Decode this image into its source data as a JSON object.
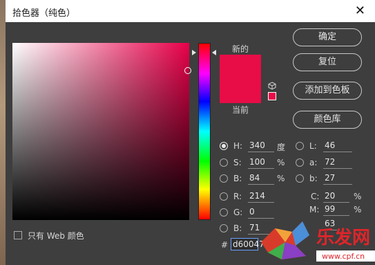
{
  "window": {
    "title": "拾色器（纯色）",
    "close_icon": "close-icon"
  },
  "swatch": {
    "new_label": "新的",
    "current_label": "当前",
    "color": "#e80c47"
  },
  "buttons": {
    "ok": "确定",
    "reset": "复位",
    "add_to_swatches": "添加到色板",
    "color_libraries": "颜色库"
  },
  "hsb": {
    "h": {
      "label": "H:",
      "value": "340",
      "unit": "度"
    },
    "s": {
      "label": "S:",
      "value": "100",
      "unit": "%"
    },
    "b": {
      "label": "B:",
      "value": "84",
      "unit": "%"
    }
  },
  "rgb": {
    "r": {
      "label": "R:",
      "value": "214"
    },
    "g": {
      "label": "G:",
      "value": "0"
    },
    "b": {
      "label": "B:",
      "value": "71"
    }
  },
  "lab": {
    "l": {
      "label": "L:",
      "value": "46"
    },
    "a": {
      "label": "a:",
      "value": "72"
    },
    "b": {
      "label": "b:",
      "value": "27"
    }
  },
  "cmyk": {
    "c": {
      "label": "C:",
      "value": "20",
      "unit": "%"
    },
    "m": {
      "label": "M:",
      "value": "99",
      "unit": "%"
    },
    "y": {
      "label": "",
      "value": "63",
      "unit": ""
    }
  },
  "hex": {
    "label": "#",
    "value": "d60047"
  },
  "web_only": {
    "label": "只有 Web 颜色",
    "checked": false
  },
  "watermark": {
    "text": "乐发网",
    "url": "www.cpf.cn"
  }
}
